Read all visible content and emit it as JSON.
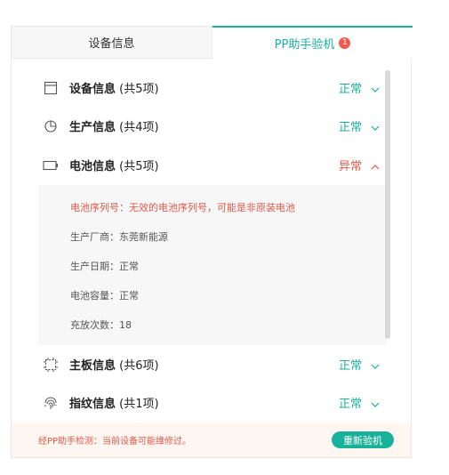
{
  "tabs": {
    "device_info": "设备信息",
    "pp_check": "PP助手验机",
    "pp_check_badge": "1"
  },
  "rows": [
    {
      "title": "设备信息",
      "count": " (共5项)",
      "status": "正常",
      "icon": "window-icon"
    },
    {
      "title": "生产信息",
      "count": " (共4项)",
      "status": "正常",
      "icon": "pie-clock-icon"
    },
    {
      "title": "电池信息",
      "count": " (共5项)",
      "status": "异常",
      "icon": "battery-icon"
    },
    {
      "title": "主板信息",
      "count": " (共6项)",
      "status": "正常",
      "icon": "chip-icon"
    },
    {
      "title": "指纹信息",
      "count": " (共1项)",
      "status": "正常",
      "icon": "fingerprint-icon"
    }
  ],
  "battery_details": [
    "电池序列号：无效的电池序列号，可能是非原装电池",
    "生产厂商：东莞新能源",
    "生产日期：正常",
    "电池容量：正常",
    "充放次数：18"
  ],
  "footer": {
    "message": "经PP助手检测：当前设备可能维修过。",
    "recheck": "重新验机"
  },
  "colors": {
    "accent": "#1ab19a",
    "warning": "#e05a4a"
  }
}
